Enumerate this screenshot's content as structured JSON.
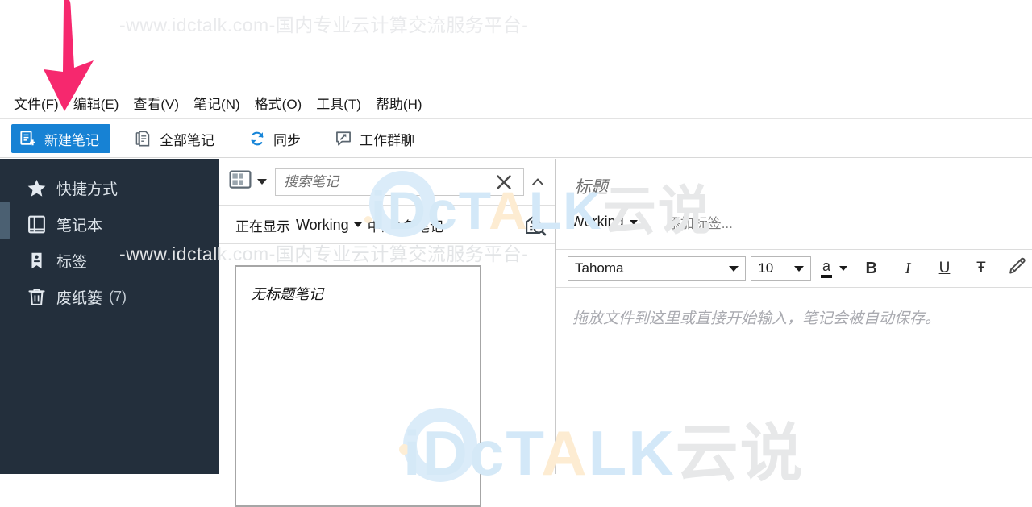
{
  "watermark": {
    "line_top": "-www.idctalk.com-国内专业云计算交流服务平台-",
    "line_mid": "-www.idctalk.com-国内专业云计算交流服务平台-",
    "logo_ic": "iDc",
    "logo_talk_1": "T",
    "logo_talk_a": "A",
    "logo_talk_2": "LK",
    "logo_cn": "云说",
    "color_blue": "#d3e8f8",
    "color_amber": "#fdecd2",
    "color_gray": "#e7e8e9"
  },
  "menubar": {
    "items": [
      {
        "label": "文件(F)",
        "name": "menu-file"
      },
      {
        "label": "编辑(E)",
        "name": "menu-edit"
      },
      {
        "label": "查看(V)",
        "name": "menu-view"
      },
      {
        "label": "笔记(N)",
        "name": "menu-note"
      },
      {
        "label": "格式(O)",
        "name": "menu-format"
      },
      {
        "label": "工具(T)",
        "name": "menu-tools"
      },
      {
        "label": "帮助(H)",
        "name": "menu-help"
      }
    ]
  },
  "toolbar": {
    "new_note_label": "新建笔记",
    "all_notes_label": "全部笔记",
    "sync_label": "同步",
    "work_chat_label": "工作群聊",
    "primary_color": "#1782d4"
  },
  "sidebar": {
    "background": "#232f3c",
    "items": [
      {
        "label": "快捷方式",
        "icon": "star-icon",
        "count": ""
      },
      {
        "label": "笔记本",
        "icon": "notebook-icon",
        "count": ""
      },
      {
        "label": "标签",
        "icon": "tag-icon",
        "count": ""
      },
      {
        "label": "废纸篓",
        "icon": "trash-icon",
        "count": "(7)"
      }
    ]
  },
  "notelist": {
    "search_placeholder": "搜索笔记",
    "search_value": "",
    "filter_prefix": "正在显示",
    "filter_notebook": "Working",
    "filter_suffix": "中的1条笔记",
    "notes": [
      {
        "title": "无标题笔记"
      }
    ]
  },
  "editor": {
    "title_placeholder": "标题",
    "notebook": "Working",
    "add_tag": "添加标签...",
    "body_placeholder": "拖放文件到这里或直接开始输入，笔记会被自动保存。",
    "format": {
      "font_family": "Tahoma",
      "font_size": "10",
      "color_glyph": "a",
      "bold": "B",
      "italic": "I",
      "underline": "U",
      "strikethrough": "Ŧ",
      "highlight_icon": "highlighter-pen-icon"
    }
  },
  "annotation": {
    "arrow_color": "#f6286e",
    "arrow_target": "新建笔记"
  }
}
